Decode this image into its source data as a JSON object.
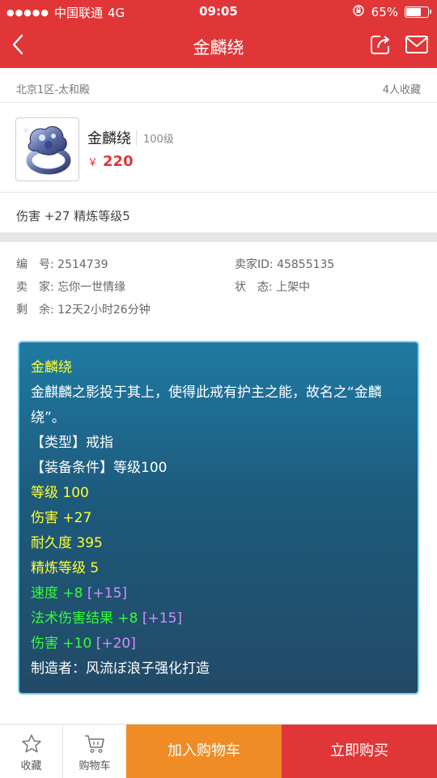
{
  "status": {
    "signal_dots": "●●●●●",
    "carrier": "中国联通",
    "network": "4G",
    "time": "09:05",
    "battery_text": "65%",
    "battery_level": 0.65
  },
  "nav": {
    "title": "金麟绕"
  },
  "listing": {
    "server": "北京1区-太和殿",
    "favorites": "4人收藏"
  },
  "item": {
    "name": "金麟绕",
    "level": "100级",
    "currency": "￥",
    "price": "220",
    "summary": "伤害 +27 精炼等级5"
  },
  "info": {
    "id": "编　号: 2514739",
    "seller_id": "卖家ID: 45855135",
    "seller": "卖　家: 忘你一世情缘",
    "status": "状　态: 上架中",
    "remaining": "剩　余: 12天2小时26分钟"
  },
  "description": {
    "title": "金麟绕",
    "flavor": "金麒麟之影投于其上，使得此戒有护主之能，故名之“金麟绕”。",
    "type": "【类型】戒指",
    "requirement": "【装备条件】等级100",
    "level": "等级 100",
    "damage": "伤害 +27",
    "durability": "耐久度 395",
    "refine": "精炼等级 5",
    "speed": "速度 +8",
    "speed_bonus": "[+15]",
    "magic": "法术伤害结果 +8",
    "magic_bonus": "[+15]",
    "dmg_extra": "伤害 +10",
    "dmg_extra_bonus": "[+20]",
    "maker": "制造者：风流ぼ浪子强化打造"
  },
  "bottom": {
    "fav_label": "收藏",
    "cart_label": "购物车",
    "add_cart": "加入购物车",
    "buy_now": "立即购买"
  },
  "colors": {
    "brand_red": "#e13638",
    "orange": "#ef8c25",
    "desc_yellow": "#ffff33",
    "desc_green": "#33ff33",
    "desc_purple": "#d48cff"
  }
}
